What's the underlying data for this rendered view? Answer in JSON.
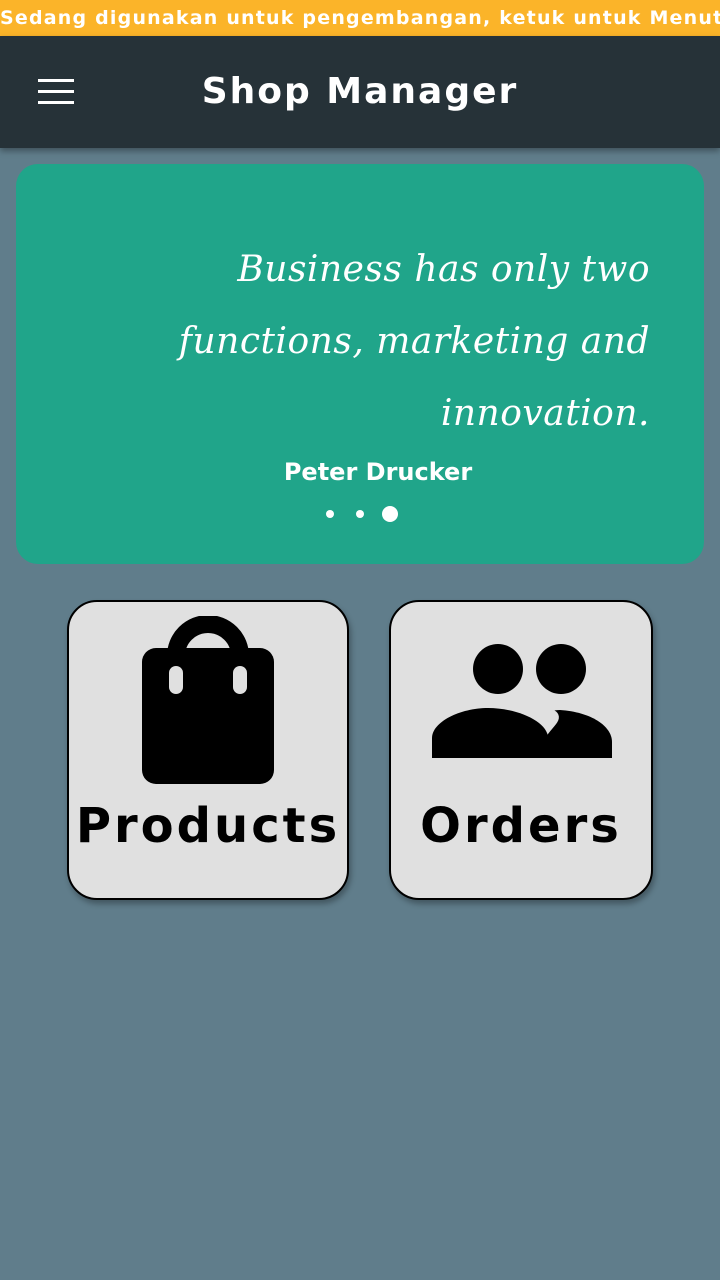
{
  "dev_banner": {
    "text": "Sedang digunakan untuk pengembangan, ketuk untuk Menutup"
  },
  "app_bar": {
    "title": "Shop Manager",
    "menu_icon": "hamburger-menu-icon"
  },
  "quote_carousel": {
    "quote": "Business has only two functions, marketing and innovation.",
    "author": "Peter Drucker",
    "page_count": 3,
    "active_page": 3
  },
  "tiles": [
    {
      "label": "Products",
      "icon": "shopping-bag-icon"
    },
    {
      "label": "Orders",
      "icon": "people-group-icon"
    }
  ],
  "colors": {
    "dev_banner": "#fbb429",
    "app_bar": "#263238",
    "background": "#607d8b",
    "quote_card": "#20a58a",
    "tile": "#e0e0e0"
  }
}
